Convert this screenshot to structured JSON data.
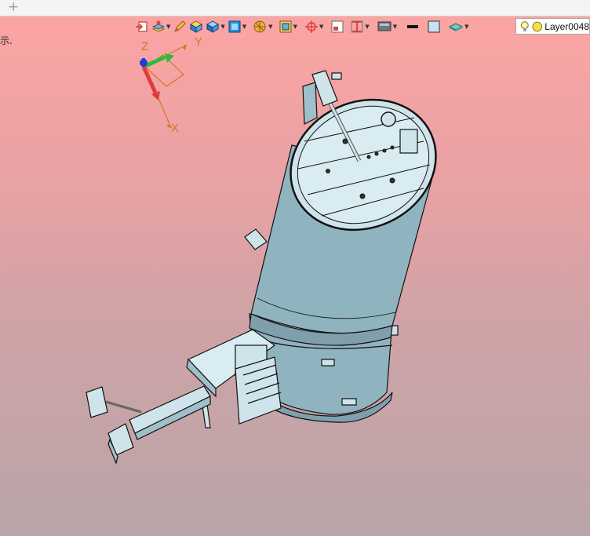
{
  "tabbar": {
    "add_tab_label": "+"
  },
  "viewport": {
    "hint_text": "示."
  },
  "toolbar": {
    "items": [
      {
        "name": "export-icon"
      },
      {
        "name": "layers-icon"
      },
      {
        "name": "pencil-icon"
      },
      {
        "name": "box-yellow-icon"
      },
      {
        "name": "box-blue-icon"
      },
      {
        "name": "render-mode-icon"
      },
      {
        "name": "section-icon"
      },
      {
        "name": "view-fit-icon"
      },
      {
        "name": "origin-icon"
      },
      {
        "name": "frame-icon"
      },
      {
        "name": "dimension-icon"
      },
      {
        "name": "display-icon"
      },
      {
        "name": "line-color-icon"
      },
      {
        "name": "fill-color-icon"
      },
      {
        "name": "surface-icon"
      }
    ],
    "layer_label": "Layer0048"
  },
  "axes": {
    "x_label": "X",
    "y_label": "Y",
    "z_label": "Z"
  },
  "colors": {
    "model_fill": "#8fb3bf",
    "model_light": "#cfe4ea",
    "outline": "#111111",
    "axis_x": "#e23a3a",
    "axis_y": "#2dbb3a",
    "axis_z": "#1c3fd6",
    "axis_label": "#d7751f"
  }
}
